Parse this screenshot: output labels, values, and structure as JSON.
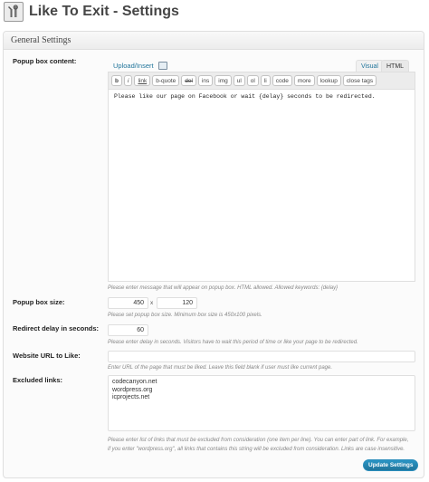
{
  "page": {
    "title": "Like To Exit - Settings",
    "icon": "tools-icon"
  },
  "section": {
    "title": "General Settings"
  },
  "popup_content": {
    "label": "Popup box content:",
    "upload_link": "Upload/Insert",
    "upload_icon": "media-icon",
    "tabs": [
      "Visual",
      "HTML"
    ],
    "active_tab": "HTML",
    "toolbar": [
      "b",
      "i",
      "link",
      "b-quote",
      "del",
      "ins",
      "img",
      "ul",
      "ol",
      "li",
      "code",
      "more",
      "lookup",
      "close tags"
    ],
    "value": "Please like our page on Facebook or wait {delay} seconds to be redirected.",
    "description": "Please enter message that will appear on popup box. HTML allowed. Allowed keywords: {delay}"
  },
  "popup_size": {
    "label": "Popup box size:",
    "width": "450",
    "separator": "x",
    "height": "120",
    "description": "Please set popup box size. Minimum box size is 450x100 pixels."
  },
  "redirect_delay": {
    "label": "Redirect delay in seconds:",
    "value": "60",
    "description": "Please enter delay in seconds. Visitors have to wait this period of time or like your page to be redirected."
  },
  "website_url": {
    "label": "Website URL to Like:",
    "value": "",
    "description": "Enter URL of the page that must be liked. Leave this field blank if user must like current page."
  },
  "excluded_links": {
    "label": "Excluded links:",
    "lines": [
      "codecanyon.net",
      "wordpress.org",
      "icprojects.net"
    ],
    "description_line1": "Please enter list of links that must be excluded from consideration (one item per line). You can enter part of link. For example,",
    "description_line2": "if you enter \"wordpress.org\", all links that contains this string will be excluded from consideration. Links are case insensitive."
  },
  "actions": {
    "update_label": "Update Settings"
  }
}
